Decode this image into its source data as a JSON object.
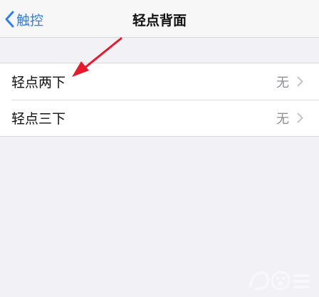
{
  "nav": {
    "back_label": "触控",
    "title": "轻点背面"
  },
  "rows": [
    {
      "label": "轻点两下",
      "value": "无"
    },
    {
      "label": "轻点三下",
      "value": "无"
    }
  ],
  "colors": {
    "accent": "#2f7cf6",
    "annotation": "#e8192c"
  }
}
